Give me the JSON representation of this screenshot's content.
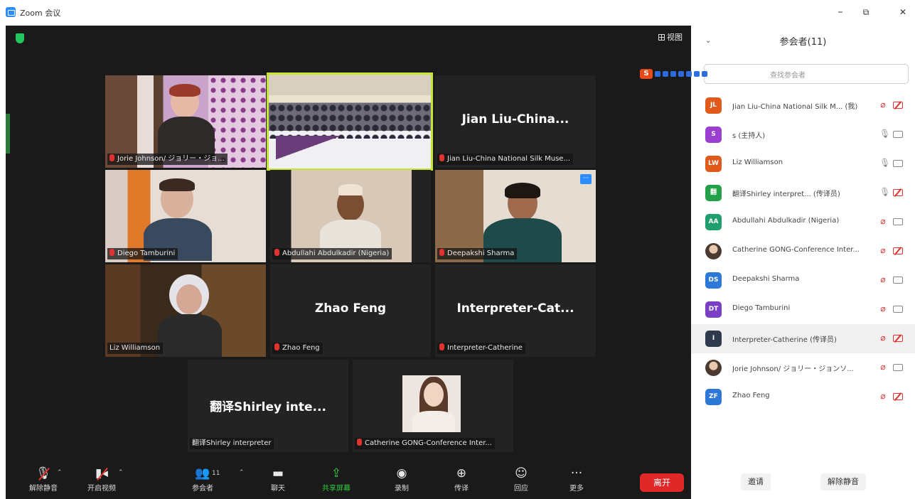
{
  "window": {
    "title": "Zoom 会议",
    "minimize": "–",
    "maximize": "⧉",
    "close": "✕"
  },
  "meeting": {
    "view_label": "视图",
    "tiles": [
      {
        "id": "jorie",
        "label": "Jorie Johnson/ ジョリー・ジョ...",
        "mic_off": true
      },
      {
        "id": "room",
        "label": "",
        "mic_off": false
      },
      {
        "id": "jian",
        "big": "Jian Liu-China...",
        "label": "Jian Liu-China National Silk Muse...",
        "mic_off": true
      },
      {
        "id": "diego",
        "label": "Diego Tamburini",
        "mic_off": true
      },
      {
        "id": "abdullahi",
        "label": "Abdullahi Abdulkadir (Nigeria)",
        "mic_off": true
      },
      {
        "id": "deepakshi",
        "label": "Deepakshi Sharma",
        "mic_off": true
      },
      {
        "id": "liz",
        "label": "Liz Williamson",
        "mic_off": false
      },
      {
        "id": "zhao",
        "big": "Zhao Feng",
        "label": "Zhao Feng",
        "mic_off": true
      },
      {
        "id": "interp",
        "big": "Interpreter-Cat...",
        "label": "Interpreter-Catherine",
        "mic_off": true
      },
      {
        "id": "shirley",
        "big": "翻译Shirley inte...",
        "label": "翻译Shirley interpreter",
        "mic_off": false
      },
      {
        "id": "catherine",
        "label": "Catherine GONG-Conference Inter...",
        "mic_off": true
      }
    ]
  },
  "toolbar": {
    "unmute": "解除静音",
    "start_video": "开启视频",
    "participants": "参会者",
    "participants_count": "11",
    "chat": "聊天",
    "share": "共享屏幕",
    "record": "录制",
    "translate": "传译",
    "reactions": "回应",
    "more": "更多",
    "leave": "离开"
  },
  "panel": {
    "title": "参会者(11)",
    "search_placeholder": "查找参会者",
    "participants": [
      {
        "initials": "JL",
        "color": "#e05a1b",
        "name": "Jian Liu-China National Silk M... (我)",
        "mic": "off",
        "cam": "off"
      },
      {
        "initials": "S",
        "color": "#9b3fd1",
        "name": "s (主持人)",
        "mic": "on",
        "cam": "on"
      },
      {
        "initials": "LW",
        "color": "#e05a1b",
        "name": "Liz Williamson",
        "mic": "on",
        "cam": "on"
      },
      {
        "initials": "翻",
        "color": "#24a148",
        "name": "翻译Shirley interpret... (传译员)",
        "mic": "on",
        "cam": "off"
      },
      {
        "initials": "AA",
        "color": "#1f9e6e",
        "name": "Abdullahi Abdulkadir (Nigeria)",
        "mic": "off",
        "cam": "on"
      },
      {
        "initials": "",
        "color": "photo",
        "name": "Catherine GONG-Conference Inter...",
        "mic": "off",
        "cam": "off"
      },
      {
        "initials": "DS",
        "color": "#2d78d6",
        "name": "Deepakshi Sharma",
        "mic": "off",
        "cam": "on"
      },
      {
        "initials": "DT",
        "color": "#7a3fc4",
        "name": "Diego Tamburini",
        "mic": "off",
        "cam": "on"
      },
      {
        "initials": "I",
        "color": "#2f3b4c",
        "name": "Interpreter-Catherine (传译员)",
        "mic": "off",
        "cam": "off",
        "highlight": true
      },
      {
        "initials": "",
        "color": "photo",
        "name": "Jorie Johnson/ ジョリー・ジョンソ...",
        "mic": "off",
        "cam": "on"
      },
      {
        "initials": "ZF",
        "color": "#2d78d6",
        "name": "Zhao Feng",
        "mic": "off",
        "cam": "off"
      }
    ],
    "invite_label": "邀请",
    "unmute_all_label": "解除静音"
  }
}
